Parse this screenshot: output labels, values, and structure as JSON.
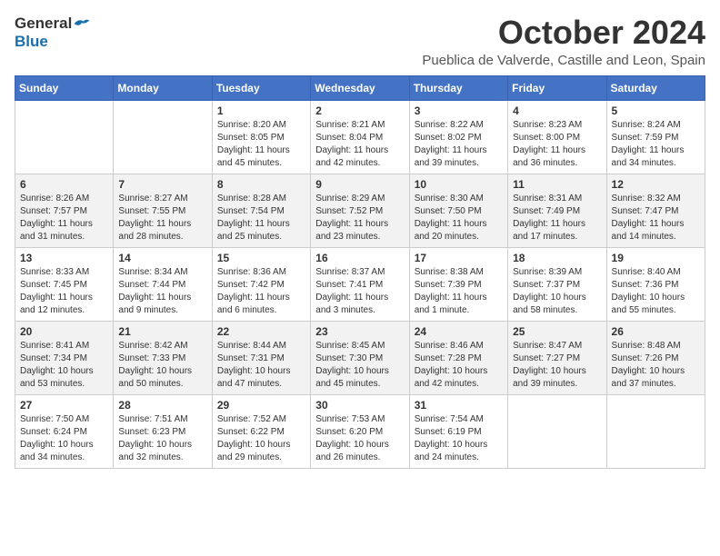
{
  "header": {
    "logo_general": "General",
    "logo_blue": "Blue",
    "month_year": "October 2024",
    "location": "Pueblica de Valverde, Castille and Leon, Spain"
  },
  "weekdays": [
    "Sunday",
    "Monday",
    "Tuesday",
    "Wednesday",
    "Thursday",
    "Friday",
    "Saturday"
  ],
  "weeks": [
    [
      {
        "day": "",
        "detail": ""
      },
      {
        "day": "",
        "detail": ""
      },
      {
        "day": "1",
        "detail": "Sunrise: 8:20 AM\nSunset: 8:05 PM\nDaylight: 11 hours and 45 minutes."
      },
      {
        "day": "2",
        "detail": "Sunrise: 8:21 AM\nSunset: 8:04 PM\nDaylight: 11 hours and 42 minutes."
      },
      {
        "day": "3",
        "detail": "Sunrise: 8:22 AM\nSunset: 8:02 PM\nDaylight: 11 hours and 39 minutes."
      },
      {
        "day": "4",
        "detail": "Sunrise: 8:23 AM\nSunset: 8:00 PM\nDaylight: 11 hours and 36 minutes."
      },
      {
        "day": "5",
        "detail": "Sunrise: 8:24 AM\nSunset: 7:59 PM\nDaylight: 11 hours and 34 minutes."
      }
    ],
    [
      {
        "day": "6",
        "detail": "Sunrise: 8:26 AM\nSunset: 7:57 PM\nDaylight: 11 hours and 31 minutes."
      },
      {
        "day": "7",
        "detail": "Sunrise: 8:27 AM\nSunset: 7:55 PM\nDaylight: 11 hours and 28 minutes."
      },
      {
        "day": "8",
        "detail": "Sunrise: 8:28 AM\nSunset: 7:54 PM\nDaylight: 11 hours and 25 minutes."
      },
      {
        "day": "9",
        "detail": "Sunrise: 8:29 AM\nSunset: 7:52 PM\nDaylight: 11 hours and 23 minutes."
      },
      {
        "day": "10",
        "detail": "Sunrise: 8:30 AM\nSunset: 7:50 PM\nDaylight: 11 hours and 20 minutes."
      },
      {
        "day": "11",
        "detail": "Sunrise: 8:31 AM\nSunset: 7:49 PM\nDaylight: 11 hours and 17 minutes."
      },
      {
        "day": "12",
        "detail": "Sunrise: 8:32 AM\nSunset: 7:47 PM\nDaylight: 11 hours and 14 minutes."
      }
    ],
    [
      {
        "day": "13",
        "detail": "Sunrise: 8:33 AM\nSunset: 7:45 PM\nDaylight: 11 hours and 12 minutes."
      },
      {
        "day": "14",
        "detail": "Sunrise: 8:34 AM\nSunset: 7:44 PM\nDaylight: 11 hours and 9 minutes."
      },
      {
        "day": "15",
        "detail": "Sunrise: 8:36 AM\nSunset: 7:42 PM\nDaylight: 11 hours and 6 minutes."
      },
      {
        "day": "16",
        "detail": "Sunrise: 8:37 AM\nSunset: 7:41 PM\nDaylight: 11 hours and 3 minutes."
      },
      {
        "day": "17",
        "detail": "Sunrise: 8:38 AM\nSunset: 7:39 PM\nDaylight: 11 hours and 1 minute."
      },
      {
        "day": "18",
        "detail": "Sunrise: 8:39 AM\nSunset: 7:37 PM\nDaylight: 10 hours and 58 minutes."
      },
      {
        "day": "19",
        "detail": "Sunrise: 8:40 AM\nSunset: 7:36 PM\nDaylight: 10 hours and 55 minutes."
      }
    ],
    [
      {
        "day": "20",
        "detail": "Sunrise: 8:41 AM\nSunset: 7:34 PM\nDaylight: 10 hours and 53 minutes."
      },
      {
        "day": "21",
        "detail": "Sunrise: 8:42 AM\nSunset: 7:33 PM\nDaylight: 10 hours and 50 minutes."
      },
      {
        "day": "22",
        "detail": "Sunrise: 8:44 AM\nSunset: 7:31 PM\nDaylight: 10 hours and 47 minutes."
      },
      {
        "day": "23",
        "detail": "Sunrise: 8:45 AM\nSunset: 7:30 PM\nDaylight: 10 hours and 45 minutes."
      },
      {
        "day": "24",
        "detail": "Sunrise: 8:46 AM\nSunset: 7:28 PM\nDaylight: 10 hours and 42 minutes."
      },
      {
        "day": "25",
        "detail": "Sunrise: 8:47 AM\nSunset: 7:27 PM\nDaylight: 10 hours and 39 minutes."
      },
      {
        "day": "26",
        "detail": "Sunrise: 8:48 AM\nSunset: 7:26 PM\nDaylight: 10 hours and 37 minutes."
      }
    ],
    [
      {
        "day": "27",
        "detail": "Sunrise: 7:50 AM\nSunset: 6:24 PM\nDaylight: 10 hours and 34 minutes."
      },
      {
        "day": "28",
        "detail": "Sunrise: 7:51 AM\nSunset: 6:23 PM\nDaylight: 10 hours and 32 minutes."
      },
      {
        "day": "29",
        "detail": "Sunrise: 7:52 AM\nSunset: 6:22 PM\nDaylight: 10 hours and 29 minutes."
      },
      {
        "day": "30",
        "detail": "Sunrise: 7:53 AM\nSunset: 6:20 PM\nDaylight: 10 hours and 26 minutes."
      },
      {
        "day": "31",
        "detail": "Sunrise: 7:54 AM\nSunset: 6:19 PM\nDaylight: 10 hours and 24 minutes."
      },
      {
        "day": "",
        "detail": ""
      },
      {
        "day": "",
        "detail": ""
      }
    ]
  ]
}
